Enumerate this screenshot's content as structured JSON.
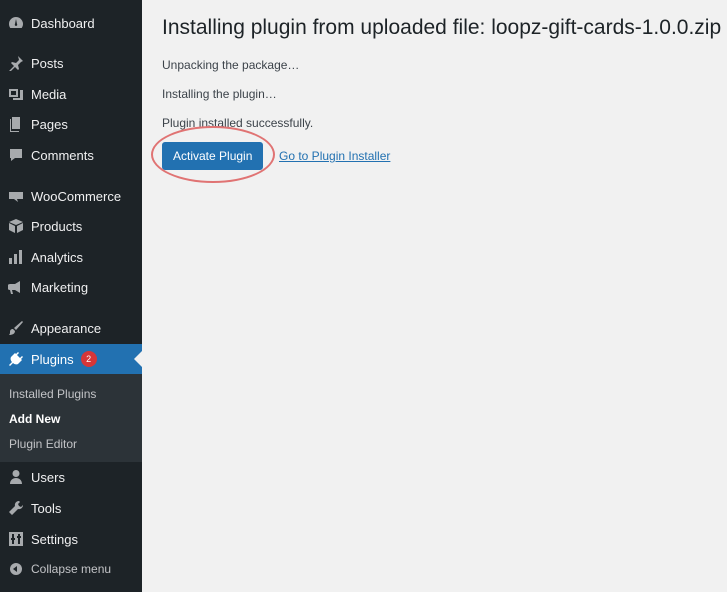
{
  "sidebar": {
    "items": [
      {
        "label": "Dashboard",
        "icon": "dashboard-icon"
      },
      {
        "label": "Posts",
        "icon": "pin-icon"
      },
      {
        "label": "Media",
        "icon": "media-icon"
      },
      {
        "label": "Pages",
        "icon": "pages-icon"
      },
      {
        "label": "Comments",
        "icon": "comment-icon"
      },
      {
        "label": "WooCommerce",
        "icon": "woo-icon"
      },
      {
        "label": "Products",
        "icon": "box-icon"
      },
      {
        "label": "Analytics",
        "icon": "bar-chart-icon"
      },
      {
        "label": "Marketing",
        "icon": "megaphone-icon"
      },
      {
        "label": "Appearance",
        "icon": "paintbrush-icon"
      },
      {
        "label": "Plugins",
        "icon": "plug-icon",
        "badge": "2",
        "active": true
      },
      {
        "label": "Users",
        "icon": "user-icon"
      },
      {
        "label": "Tools",
        "icon": "wrench-icon"
      },
      {
        "label": "Settings",
        "icon": "settings-icon"
      }
    ],
    "submenu": [
      {
        "label": "Installed Plugins"
      },
      {
        "label": "Add New",
        "current": true
      },
      {
        "label": "Plugin Editor"
      }
    ],
    "collapse_label": "Collapse menu"
  },
  "main": {
    "title": "Installing plugin from uploaded file: loopz-gift-cards-1.0.0.zip",
    "messages": [
      "Unpacking the package…",
      "Installing the plugin…",
      "Plugin installed successfully."
    ],
    "activate_label": "Activate Plugin",
    "installer_link": "Go to Plugin Installer"
  },
  "colors": {
    "sidebar_bg": "#1d2327",
    "accent": "#2271b1",
    "badge": "#d63638",
    "highlight_circle": "#e07373"
  }
}
